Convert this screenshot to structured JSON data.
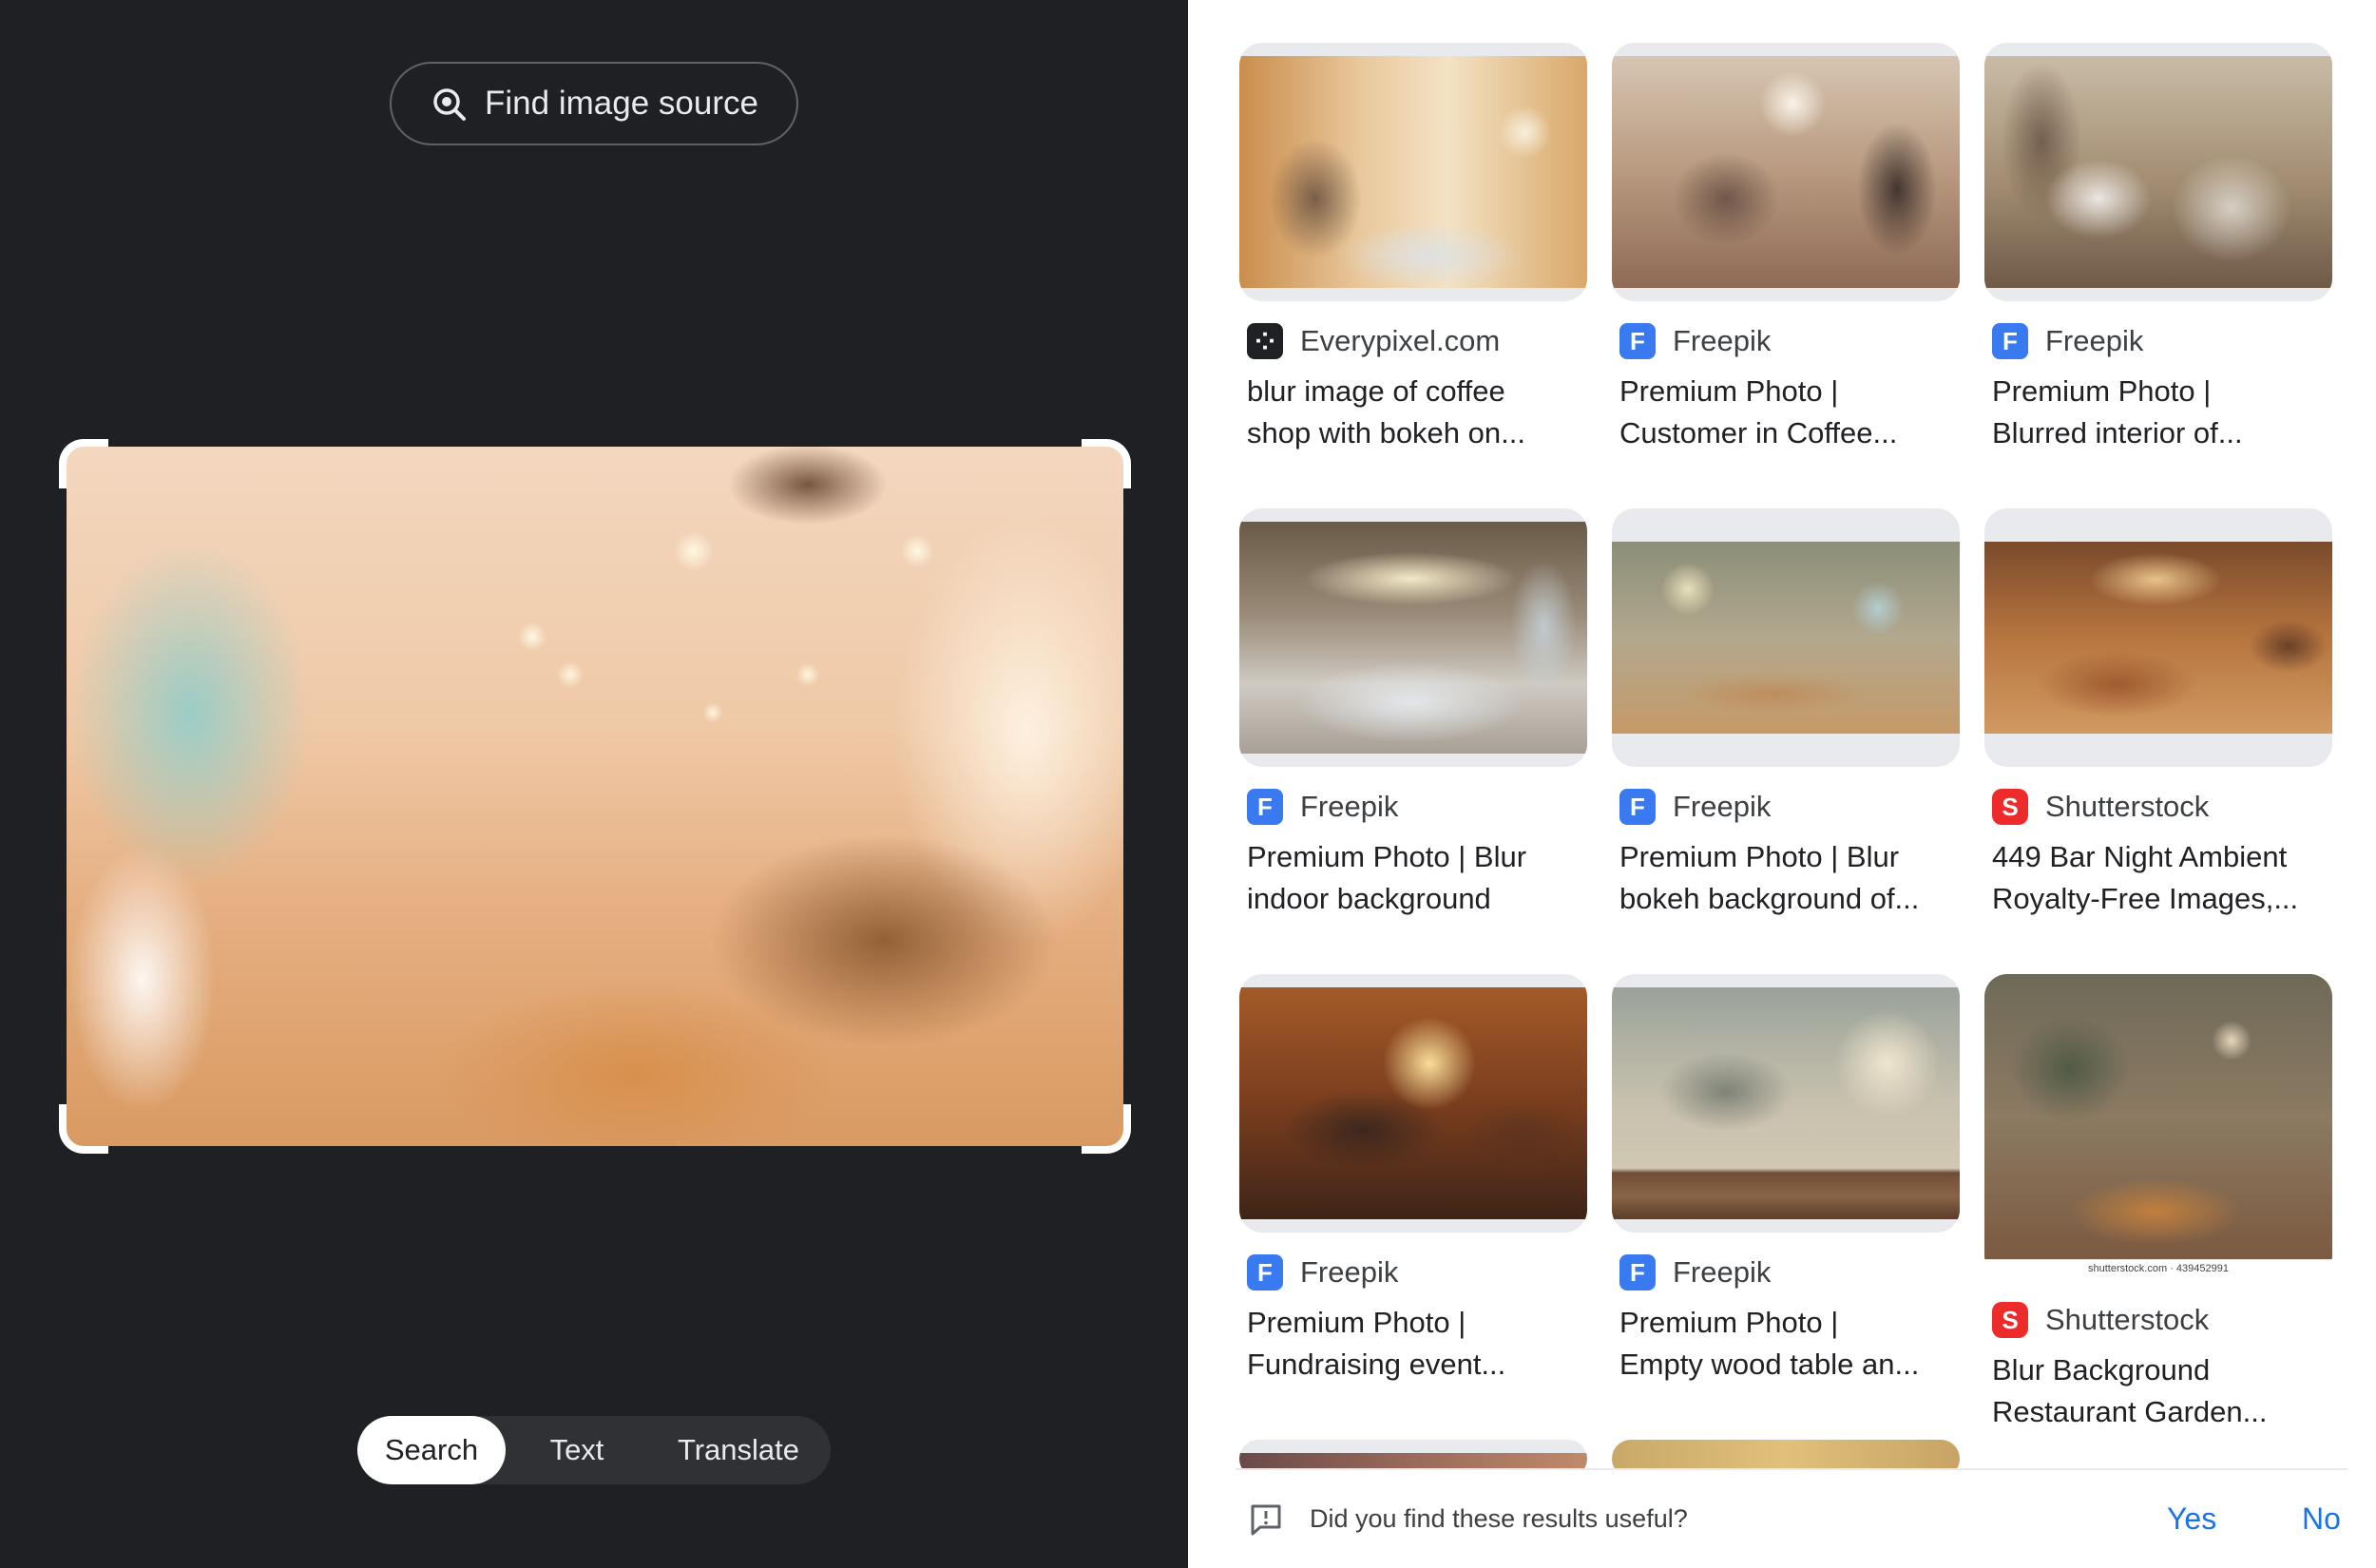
{
  "left_panel": {
    "find_source_label": "Find image source",
    "modes": [
      "Search",
      "Text",
      "Translate"
    ],
    "active_mode": "Search"
  },
  "results": [
    {
      "source": "Everypixel.com",
      "favicon": "everypixel-icon",
      "title_line1": "blur image of coffee",
      "title_line2": "shop with bokeh on..."
    },
    {
      "source": "Freepik",
      "favicon": "freepik-icon",
      "title_line1": "Premium Photo |",
      "title_line2": "Customer in Coffee..."
    },
    {
      "source": "Freepik",
      "favicon": "freepik-icon",
      "title_line1": "Premium Photo |",
      "title_line2": "Blurred interior of..."
    },
    {
      "source": "Freepik",
      "favicon": "freepik-icon",
      "title_line1": "Premium Photo | Blur",
      "title_line2": "indoor background"
    },
    {
      "source": "Freepik",
      "favicon": "freepik-icon",
      "title_line1": "Premium Photo | Blur",
      "title_line2": "bokeh background of..."
    },
    {
      "source": "Shutterstock",
      "favicon": "shutterstock-icon",
      "title_line1": "449 Bar Night Ambient",
      "title_line2": "Royalty-Free Images,..."
    },
    {
      "source": "Freepik",
      "favicon": "freepik-icon",
      "title_line1": "Premium Photo |",
      "title_line2": "Fundraising event..."
    },
    {
      "source": "Freepik",
      "favicon": "freepik-icon",
      "title_line1": "Premium Photo |",
      "title_line2": "Empty wood table an..."
    },
    {
      "source": "Shutterstock",
      "favicon": "shutterstock-icon",
      "title_line1": "Blur Background",
      "title_line2": "Restaurant Garden...",
      "watermark": "shutterstock.com · 439452991"
    }
  ],
  "feedback": {
    "question": "Did you find these results useful?",
    "yes_label": "Yes",
    "no_label": "No"
  },
  "colors": {
    "left_bg": "#1f2023",
    "link_blue": "#1a73e8",
    "freepik_blue": "#3a7af0",
    "shutterstock_red": "#ee2b2b"
  }
}
